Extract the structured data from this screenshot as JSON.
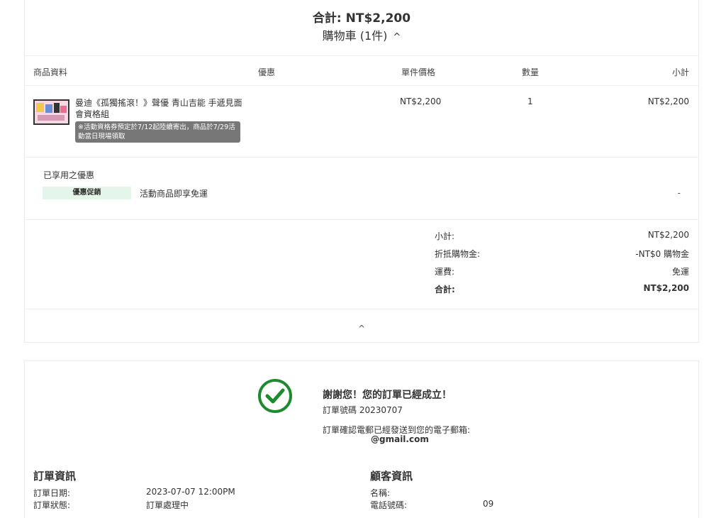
{
  "summary": {
    "total": "合計: NT$2,200",
    "cart_label": "購物車 (1件)",
    "cart_chevron": "^"
  },
  "table": {
    "headers": [
      "商品資料",
      "優惠",
      "單件價格",
      "數量",
      "小計"
    ],
    "item": {
      "name": "曼迪《孤獨搖滾！》聲優 青山吉能 手遞見面會資格組",
      "notice": "※活動資格券預定於7/12起陸續寄出，商品於7/29活動當日現場領取",
      "unit_price": "NT$2,200",
      "quantity": "1",
      "subtotal": "NT$2,200",
      "thumbnail_icon": "product-image"
    }
  },
  "promotions": {
    "title": "已享用之優惠",
    "badge": "優惠促銷",
    "description": "活動商品即享免運",
    "amount": "-"
  },
  "totals": {
    "subtotal_label": "小計:",
    "subtotal_value": "NT$2,200",
    "credit_label": "折抵購物金:",
    "credit_value": "-NT$0 購物金",
    "shipping_label": "運費:",
    "shipping_value": "免運",
    "total_label": "合計:",
    "total_value": "NT$2,200"
  },
  "collapse_icon": "^",
  "thankyou": {
    "icon": "check-circle-icon",
    "accent_color": "#1e8a2e",
    "title": "謝謝您！您的訂單已經成立！",
    "order_number": "訂單號碼 20230707",
    "email_notice": "訂單確認電郵已經發送到您的電子郵箱:",
    "email": "@gmail.com"
  },
  "order_info": {
    "title": "訂單資訊",
    "date_label": "訂單日期:",
    "date_value": "2023-07-07 12:00PM",
    "status_label": "訂單狀態:",
    "status_value": "訂單處理中"
  },
  "customer_info": {
    "title": "顧客資訊",
    "name_label": "名稱:",
    "name_value": "",
    "phone_label": "電話號碼:",
    "phone_value": "09"
  }
}
